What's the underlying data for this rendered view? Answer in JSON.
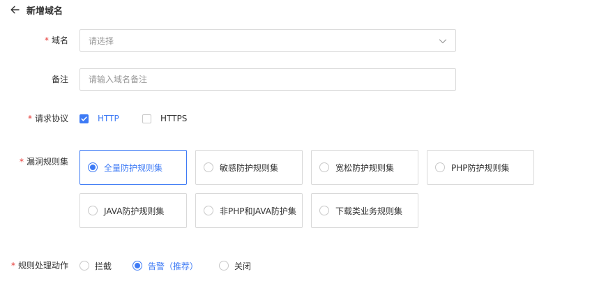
{
  "header": {
    "title": "新增域名",
    "back_icon": "arrow-left-icon"
  },
  "domain_field": {
    "label": "域名",
    "required": true,
    "placeholder": "请选择"
  },
  "remark_field": {
    "label": "备注",
    "required": false,
    "placeholder": "请输入域名备注",
    "value": ""
  },
  "protocol_field": {
    "label": "请求协议",
    "required": true,
    "options": [
      {
        "label": "HTTP",
        "checked": true
      },
      {
        "label": "HTTPS",
        "checked": false
      }
    ]
  },
  "ruleset_field": {
    "label": "漏洞规则集",
    "required": true,
    "options": [
      {
        "label": "全量防护规则集",
        "selected": true
      },
      {
        "label": "敏感防护规则集",
        "selected": false
      },
      {
        "label": "宽松防护规则集",
        "selected": false
      },
      {
        "label": "PHP防护规则集",
        "selected": false
      },
      {
        "label": "JAVA防护规则集",
        "selected": false
      },
      {
        "label": "非PHP和JAVA防护集",
        "selected": false
      },
      {
        "label": "下载类业务规则集",
        "selected": false
      }
    ]
  },
  "action_field": {
    "label": "规则处理动作",
    "required": true,
    "options": [
      {
        "label": "拦截",
        "selected": false
      },
      {
        "label": "告警（推荐）",
        "selected": true
      },
      {
        "label": "关闭",
        "selected": false
      }
    ]
  },
  "colors": {
    "accent": "#3d7af5",
    "required": "#e53935",
    "border": "#d9d9d9",
    "placeholder": "#999999",
    "text": "#333333"
  }
}
